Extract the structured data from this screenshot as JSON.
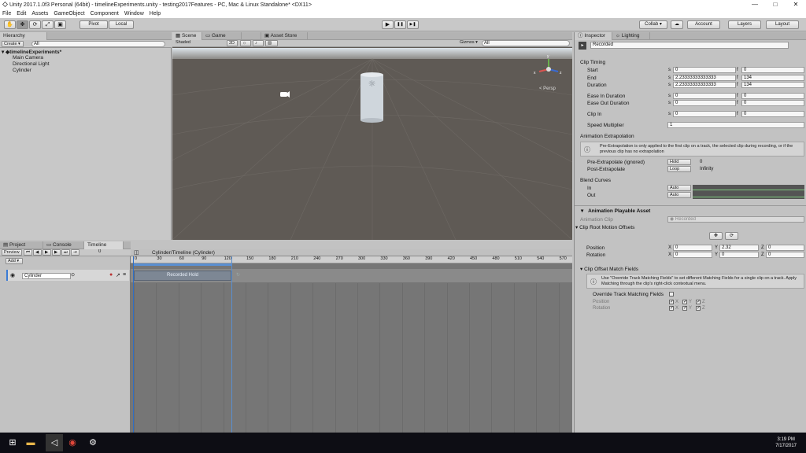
{
  "window": {
    "title": "Unity 2017.1.0f3 Personal (64bit) - timelineExperiments.unity - testing2017Features - PC, Mac & Linux Standalone* <DX11>",
    "min": "—",
    "max": "□",
    "close": "✕"
  },
  "menu": [
    "File",
    "Edit",
    "Assets",
    "GameObject",
    "Component",
    "Window",
    "Help"
  ],
  "toolbar": {
    "pivot": "Pivot",
    "local": "Local",
    "play": "▶",
    "pause": "❚❚",
    "step": "▶❚",
    "collab": "Collab ▾",
    "cloud": "☁",
    "account": "Account",
    "layers": "Layers",
    "layout": "Layout"
  },
  "hierarchy": {
    "tab": "Hierarchy",
    "create": "Create ▾",
    "search_placeholder": "All",
    "scene": "timelineExperiments*",
    "items": [
      "Main Camera",
      "Directional Light",
      "Cylinder"
    ]
  },
  "scene": {
    "tabs": [
      "Scene",
      "Game",
      "Asset Store"
    ],
    "shaded": "Shaded",
    "mode2d": "2D",
    "gizmos": "Gizmos ▾",
    "search_placeholder": "All",
    "persp": "< Persp",
    "axis": {
      "y": "y",
      "x": "x",
      "z": "z"
    }
  },
  "inspector": {
    "tabs": [
      "Inspector",
      "Lighting"
    ],
    "object_name": "Recorded",
    "clip_timing": "Clip Timing",
    "timing": [
      {
        "label": "Start",
        "s": "0",
        "f": "0"
      },
      {
        "label": "End",
        "s": "2.23333333333333",
        "f": "134"
      },
      {
        "label": "Duration",
        "s": "2.23333333333333",
        "f": "134"
      },
      {
        "label": "Ease In Duration",
        "s": "0",
        "f": "0"
      },
      {
        "label": "Ease Out Duration",
        "s": "0",
        "f": "0"
      },
      {
        "label": "Clip In",
        "s": "0",
        "f": "0"
      }
    ],
    "s_label": "s",
    "f_label": "f",
    "speed_label": "Speed Multiplier",
    "speed": "1",
    "anim_extrap": "Animation Extrapolation",
    "extrap_info": "Pre-Extrapolation is only applied to the first clip on a track, the selected clip during recording, or if the previous clip has no extrapolation",
    "pre_label": "Pre-Extrapolate (ignored)",
    "pre_value": "Hold",
    "pre_num": "0",
    "post_label": "Post-Extrapolate",
    "post_value": "Loop",
    "post_num": "Infinity",
    "blend": "Blend Curves",
    "in_label": "In",
    "out_label": "Out",
    "auto": "Auto",
    "playable_header": "Animation Playable Asset",
    "anim_clip_label": "Animation Clip",
    "anim_clip_value": "Recorded",
    "root_motion": "Clip Root Motion Offsets",
    "position_label": "Position",
    "rotation_label": "Rotation",
    "position": {
      "x": "0",
      "y": "2.32",
      "z": "0"
    },
    "rotation": {
      "x": "0",
      "y": "0",
      "z": "0"
    },
    "x": "X",
    "y": "Y",
    "z": "Z",
    "match_fields": "Clip Offset Match Fields",
    "match_info": "Use \"Override Track Matching Fields\" to set different Matching Fields for a single clip on a track. Apply Matching through the clip's right-click contextual menu.",
    "override_label": "Override Track Matching Fields",
    "mpos_label": "Position",
    "mrot_label": "Rotation"
  },
  "bottom": {
    "tabs": [
      "Project",
      "Console",
      "Timeline"
    ],
    "preview": "Preview",
    "frame": "0",
    "add": "Add ▾",
    "track": "Cylinder",
    "breadcrumb": "Cylinder/Timeline (Cylinder)",
    "clip": "Recorded Hold",
    "ruler": [
      "0",
      "30",
      "60",
      "90",
      "120",
      "150",
      "180",
      "210",
      "240",
      "270",
      "300",
      "330",
      "360",
      "390",
      "420",
      "450",
      "480",
      "510",
      "540",
      "570"
    ]
  },
  "taskbar": {
    "time": "3:19 PM",
    "date": "7/17/2017"
  }
}
